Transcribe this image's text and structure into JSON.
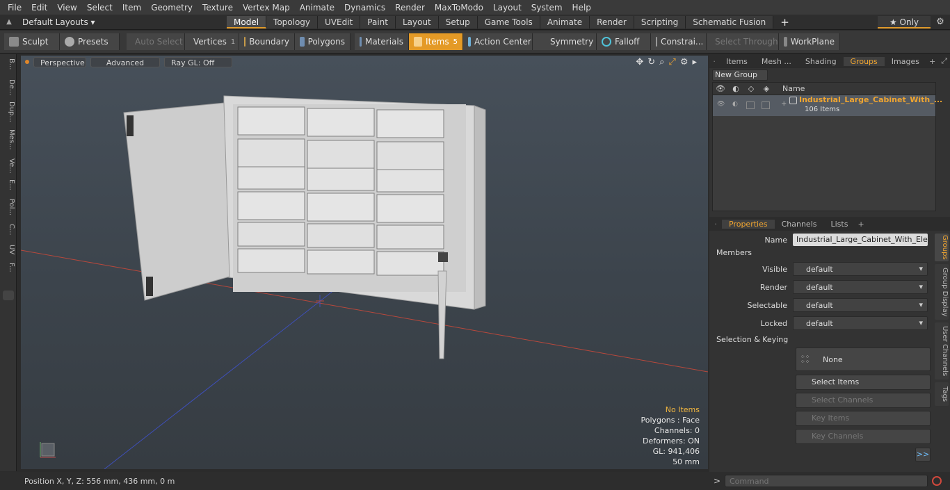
{
  "menu": [
    "File",
    "Edit",
    "View",
    "Select",
    "Item",
    "Geometry",
    "Texture",
    "Vertex Map",
    "Animate",
    "Dynamics",
    "Render",
    "MaxToModo",
    "Layout",
    "System",
    "Help"
  ],
  "layout": {
    "dropdown": "Default Layouts ▾",
    "tabs": [
      "Model",
      "Topology",
      "UVEdit",
      "Paint",
      "Layout",
      "Setup",
      "Game Tools",
      "Animate",
      "Render",
      "Scripting",
      "Schematic Fusion"
    ],
    "add": "+",
    "only": "★ Only",
    "gear": "⚙"
  },
  "toolbar": {
    "sculpt": "Sculpt",
    "presets": "Presets",
    "auto_select": "Auto Select",
    "vertices": "Vertices",
    "vertices_count": "1",
    "boundary": "Boundary",
    "polygons": "Polygons",
    "materials": "Materials",
    "items": "Items",
    "items_count": "5",
    "action_center": "Action Center",
    "symmetry": "Symmetry",
    "falloff": "Falloff",
    "constraints": "Constrai...",
    "select_through": "Select Through",
    "workplane": "WorkPlane"
  },
  "left_tabs": [
    "B...",
    "De...",
    "Dup...",
    "Mes...",
    "Ve...",
    "E...",
    "Pol...",
    "C...",
    "UV",
    "F..."
  ],
  "viewport": {
    "perspective": "Perspective",
    "advanced": "Advanced",
    "raygl": "Ray GL: Off"
  },
  "stats": {
    "no_items": "No Items",
    "polygons": "Polygons : Face",
    "channels": "Channels: 0",
    "deformers": "Deformers: ON",
    "gl": "GL: 941,406",
    "scale": "50 mm"
  },
  "status": {
    "position": "Position X, Y, Z:  556 mm, 436 mm, 0 m"
  },
  "groups_panel": {
    "tabs": [
      "Items",
      "Mesh ...",
      "Shading",
      "Groups",
      "Images"
    ],
    "new_group": "New Group",
    "col_name": "Name",
    "group_name": "Industrial_Large_Cabinet_With_...",
    "group_count": "106 Items"
  },
  "properties": {
    "tabs": [
      "Properties",
      "Channels",
      "Lists"
    ],
    "name_label": "Name",
    "name_value": "Industrial_Large_Cabinet_With_Electr",
    "members": "Members",
    "visible_label": "Visible",
    "visible_value": "default",
    "render_label": "Render",
    "render_value": "default",
    "selectable_label": "Selectable",
    "selectable_value": "default",
    "locked_label": "Locked",
    "locked_value": "default",
    "sel_keying": "Selection & Keying",
    "none": "None",
    "select_items": "Select Items",
    "select_channels": "Select Channels",
    "key_items": "Key Items",
    "key_channels": "Key Channels",
    "more": ">>",
    "side_tabs": [
      "Groups",
      "Group Display",
      "User Channels",
      "Tags"
    ]
  },
  "command": {
    "placeholder": "Command",
    "prompt": ">"
  }
}
